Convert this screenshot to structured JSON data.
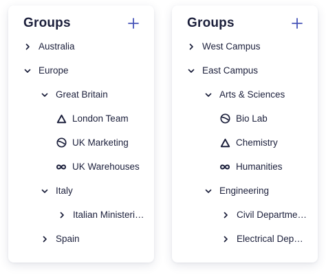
{
  "panels": [
    {
      "title": "Groups",
      "add_icon": "plus-icon",
      "accent": "#4553b8",
      "rows": [
        {
          "label": "Australia",
          "icon": "chevron-right-icon"
        },
        {
          "label": "Europe",
          "icon": "chevron-down-icon"
        },
        {
          "label": "Great Britain",
          "icon": "chevron-down-icon"
        },
        {
          "label": "London Team",
          "icon": "triangle-logo-icon"
        },
        {
          "label": "UK Marketing",
          "icon": "circle-slash-logo-icon"
        },
        {
          "label": "UK Warehouses",
          "icon": "infinity-logo-icon"
        },
        {
          "label": "Italy",
          "icon": "chevron-down-icon"
        },
        {
          "label": "Italian Ministeri…",
          "icon": "chevron-right-icon"
        },
        {
          "label": "Spain",
          "icon": "chevron-right-icon"
        }
      ]
    },
    {
      "title": "Groups",
      "add_icon": "plus-icon",
      "accent": "#4553b8",
      "rows": [
        {
          "label": "West Campus",
          "icon": "chevron-right-icon"
        },
        {
          "label": "East Campus",
          "icon": "chevron-down-icon"
        },
        {
          "label": "Arts & Sciences",
          "icon": "chevron-down-icon"
        },
        {
          "label": "Bio Lab",
          "icon": "circle-slash-logo-icon"
        },
        {
          "label": "Chemistry",
          "icon": "triangle-logo-icon"
        },
        {
          "label": "Humanities",
          "icon": "infinity-logo-icon"
        },
        {
          "label": "Engineering",
          "icon": "chevron-down-icon"
        },
        {
          "label": "Civil Departmen…",
          "icon": "chevron-right-icon"
        },
        {
          "label": "Electrical Depar…",
          "icon": "chevron-right-icon"
        }
      ]
    }
  ]
}
